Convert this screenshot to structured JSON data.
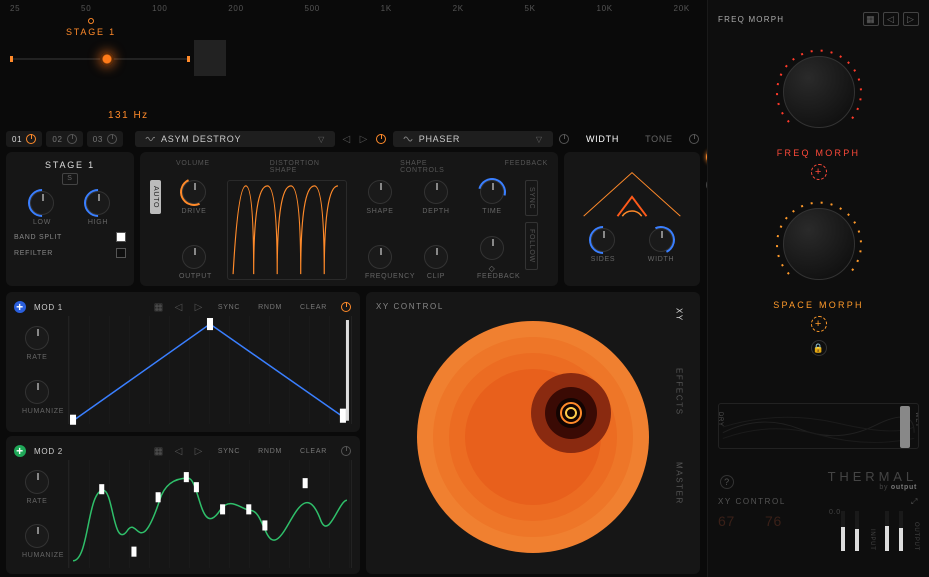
{
  "freq_strip": {
    "ticks": [
      "25",
      "50",
      "100",
      "200",
      "500",
      "1K",
      "2K",
      "5K",
      "10K",
      "20K"
    ],
    "stage_label": "STAGE 1",
    "readout": "131 Hz"
  },
  "tabs": {
    "stages": [
      {
        "label": "01",
        "on": true
      },
      {
        "label": "02",
        "on": false
      },
      {
        "label": "03",
        "on": false
      }
    ],
    "fx1": {
      "name": "ASYM DESTROY"
    },
    "fx2": {
      "name": "PHASER"
    },
    "width": "WIDTH",
    "tone": "TONE"
  },
  "stage": {
    "title": "STAGE 1",
    "solo": "S",
    "low": "LOW",
    "high": "HIGH",
    "band_split": "BAND SPLIT",
    "refilter": "REFILTER"
  },
  "dist": {
    "hdr": {
      "volume": "VOLUME",
      "shape": "DISTORTION SHAPE",
      "ctrls": "SHAPE CONTROLS",
      "fb": "FEEDBACK"
    },
    "auto": "AUTO",
    "sync": "SYNC",
    "follow": "FOLLOW",
    "drive": "DRIVE",
    "output": "OUTPUT",
    "k_shape": "SHAPE",
    "k_depth": "DEPTH",
    "k_time": "TIME",
    "k_freq": "FREQUENCY",
    "k_clip": "CLIP",
    "k_fb": "FEEDBACK"
  },
  "width": {
    "sides": "SIDES",
    "w": "WIDTH"
  },
  "mod": {
    "m1": "MOD 1",
    "m2": "MOD 2",
    "rate": "RATE",
    "humanize": "HUMANIZE",
    "sync": "SYNC",
    "rndm": "RNDM",
    "clear": "CLEAR"
  },
  "xy": {
    "title": "XY CONTROL"
  },
  "side_tabs": {
    "xy": "XY",
    "fx": "EFFECTS",
    "master": "MASTER"
  },
  "right": {
    "title": "FREQ MORPH",
    "k1": "FREQ MORPH",
    "k2": "SPACE MORPH",
    "dry": "DRY",
    "wet": "WET",
    "brand": "THERMAL",
    "by": "by",
    "maker": "output",
    "xy_title": "XY CONTROL",
    "xy_expand": "⤢",
    "xy_x": "67",
    "xy_y": "76",
    "scale": "0.0",
    "in": "INPUT",
    "out": "OUTPUT"
  }
}
